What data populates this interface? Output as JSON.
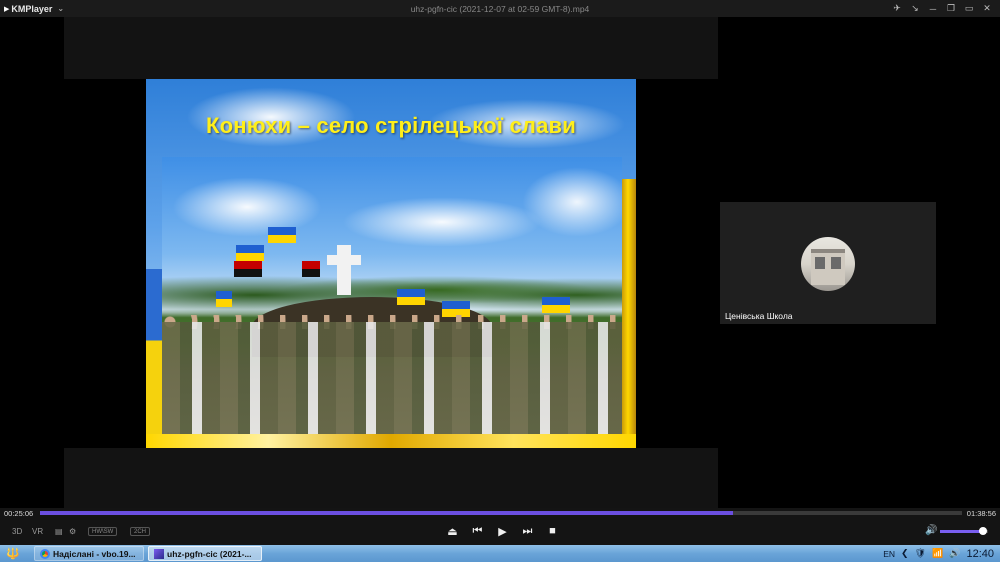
{
  "titlebar": {
    "app_name": "KMPlayer",
    "title": "uhz-pgfn-cic (2021-12-07 at 02-59 GMT-8).mp4",
    "logo_glyph": "▶",
    "menu_caret": "⌄",
    "controls": [
      "✈",
      "↘",
      "─",
      "❐",
      "▭",
      "✕"
    ]
  },
  "video": {
    "slide_title": "Конюхи – село стрілецької слави",
    "participant_name": "Ценівська Школа"
  },
  "player": {
    "time_elapsed": "00:25:06",
    "time_total": "01:38:56",
    "progress_fraction": 0.752,
    "mode_3d": "3D",
    "mode_vr": "VR",
    "menu_icon": "▤",
    "settings_icon": "⚙",
    "badge_1": "HW\\SW",
    "badge_2": "2CH",
    "volume_fraction": 0.9,
    "volume_icon": "🔊",
    "transport": [
      "⏏",
      "⏮",
      "▶",
      "⏭",
      "■"
    ]
  },
  "taskbar": {
    "start_glyph": "🔱",
    "tasks": [
      {
        "label": "Надіслані - vbo.19..."
      },
      {
        "label": "uhz-pgfn-cic (2021-..."
      }
    ],
    "language": "EN",
    "tray_icons": [
      "❮",
      "🛡",
      "📶",
      "🔊"
    ],
    "clock": "12:40"
  },
  "colors": {
    "accent": "#6b4fe0",
    "slide_title": "#ffef1a",
    "taskbar": "#6aa4d8"
  }
}
